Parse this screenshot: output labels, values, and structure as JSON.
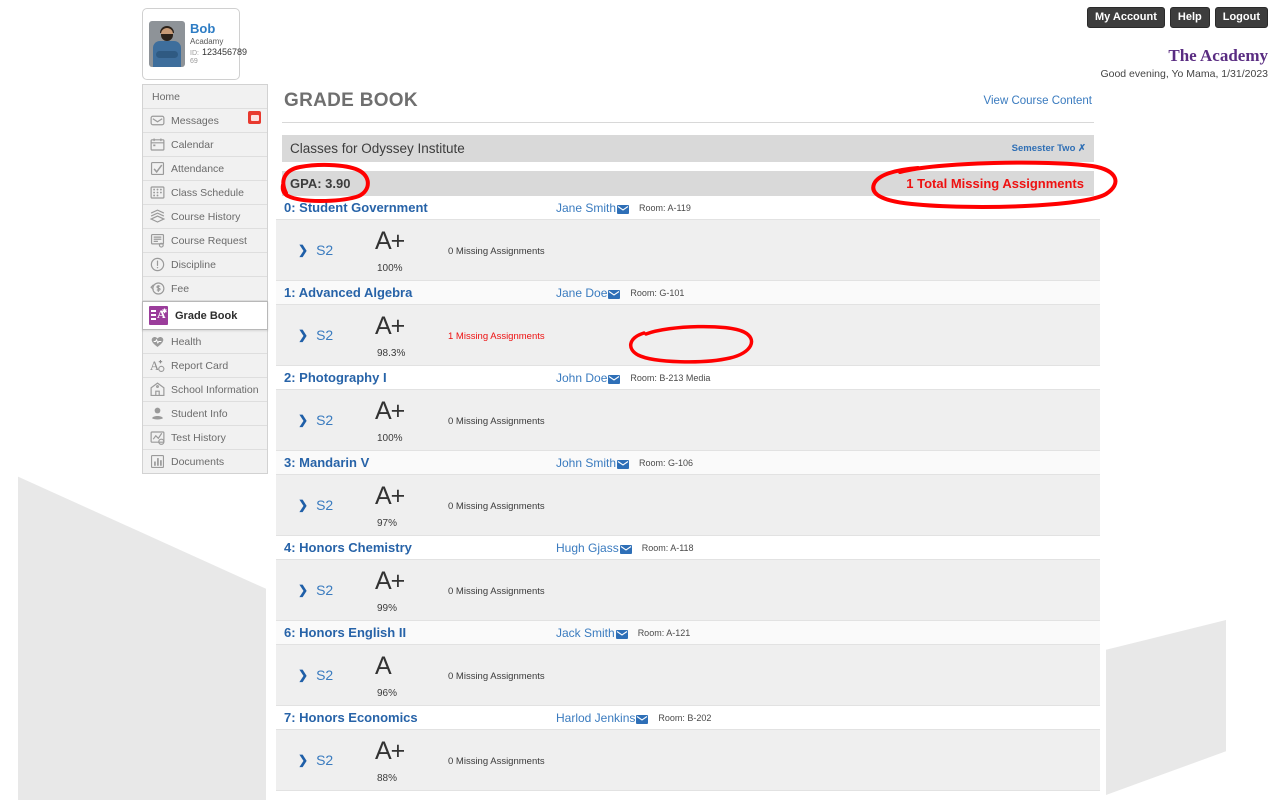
{
  "topnav": {
    "my_account": "My Account",
    "help": "Help",
    "logout": "Logout"
  },
  "student_card": {
    "name": "Bob",
    "school": "Acadamy",
    "id_label": "ID: 69",
    "id_number": "123456789"
  },
  "header": {
    "brand": "The Academy",
    "greeting": "Good evening, Yo Mama, 1/31/2023"
  },
  "sidebar": {
    "items": [
      {
        "label": "Home",
        "icon": "none"
      },
      {
        "label": "Messages",
        "icon": "envelope-icon",
        "badge": true
      },
      {
        "label": "Calendar",
        "icon": "calendar-icon"
      },
      {
        "label": "Attendance",
        "icon": "checkbox-icon"
      },
      {
        "label": "Class Schedule",
        "icon": "grid-icon"
      },
      {
        "label": "Course History",
        "icon": "books-icon"
      },
      {
        "label": "Course Request",
        "icon": "form-icon"
      },
      {
        "label": "Discipline",
        "icon": "exclamation-circle-icon"
      },
      {
        "label": "Fee",
        "icon": "dollar-icon"
      },
      {
        "label": "Grade Book",
        "icon": "gradebook-icon",
        "active": true
      },
      {
        "label": "Health",
        "icon": "heart-icon"
      },
      {
        "label": "Report Card",
        "icon": "a-plus-icon"
      },
      {
        "label": "School Information",
        "icon": "school-icon"
      },
      {
        "label": "Student Info",
        "icon": "person-icon"
      },
      {
        "label": "Test History",
        "icon": "chart-line-icon"
      },
      {
        "label": "Documents",
        "icon": "bar-chart-icon"
      }
    ]
  },
  "main": {
    "page_title": "GRADE BOOK",
    "view_course_content": "View Course Content",
    "classes_title": "Classes for Odyssey Institute",
    "semester": "Semester Two",
    "gpa": "GPA: 3.90",
    "total_missing": "1 Total Missing Assignments",
    "courses": [
      {
        "name": "0: Student Government",
        "teacher": "Jane Smith",
        "room": "Room: A-119",
        "term": "S2",
        "grade": "A+",
        "percent": "100%",
        "missing": "0 Missing Assignments",
        "missing_flag": false
      },
      {
        "name": "1: Advanced Algebra",
        "teacher": "Jane Doe",
        "room": "Room: G-101",
        "term": "S2",
        "grade": "A+",
        "percent": "98.3%",
        "missing": "1 Missing Assignments",
        "missing_flag": true
      },
      {
        "name": "2: Photography I",
        "teacher": "John Doe",
        "room": "Room: B-213 Media",
        "term": "S2",
        "grade": "A+",
        "percent": "100%",
        "missing": "0 Missing Assignments",
        "missing_flag": false
      },
      {
        "name": "3: Mandarin V",
        "teacher": "John Smith",
        "room": "Room: G-106",
        "term": "S2",
        "grade": "A+",
        "percent": "97%",
        "missing": "0 Missing Assignments",
        "missing_flag": false
      },
      {
        "name": "4: Honors Chemistry",
        "teacher": "Hugh Gjass",
        "room": "Room: A-118",
        "term": "S2",
        "grade": "A+",
        "percent": "99%",
        "missing": "0 Missing Assignments",
        "missing_flag": false
      },
      {
        "name": "6: Honors English II",
        "teacher": "Jack Smith",
        "room": "Room: A-121",
        "term": "S2",
        "grade": "A",
        "percent": "96%",
        "missing": "0 Missing Assignments",
        "missing_flag": false
      },
      {
        "name": "7: Honors Economics",
        "teacher": "Harlod Jenkins",
        "room": "Room: B-202",
        "term": "S2",
        "grade": "A+",
        "percent": "88%",
        "missing": "0 Missing Assignments",
        "missing_flag": false
      }
    ]
  },
  "colors": {
    "annotation_red": "#ff0000",
    "link_blue": "#3a7bbf",
    "course_blue": "#2763a8",
    "brand_purple": "#5a2d82",
    "accent_purple": "#9b3d9b",
    "missing_red": "#ee1111"
  }
}
